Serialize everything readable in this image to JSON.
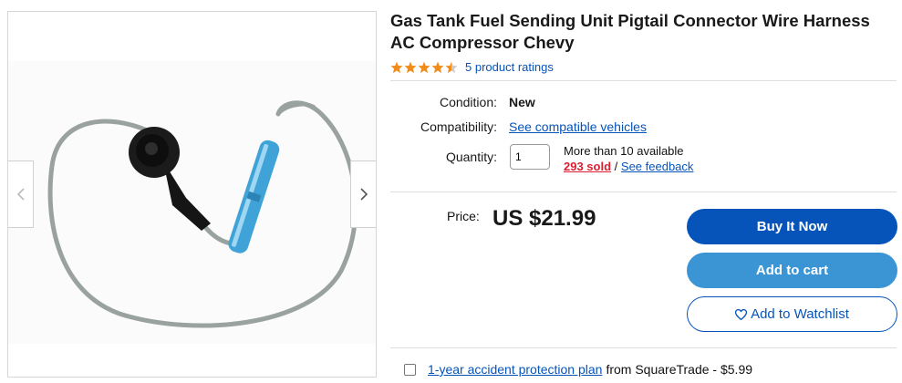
{
  "product": {
    "title": "Gas Tank Fuel Sending Unit Pigtail Connector Wire Harness AC Compressor Chevy",
    "rating_stars": 4.5,
    "ratings_link": "5 product ratings"
  },
  "details": {
    "condition_label": "Condition:",
    "condition_value": "New",
    "compat_label": "Compatibility:",
    "compat_link": "See compatible vehicles",
    "qty_label": "Quantity:",
    "qty_value": "1",
    "availability": "More than 10 available",
    "sold": "293 sold",
    "separator": "/",
    "feedback": "See feedback"
  },
  "price": {
    "label": "Price:",
    "value": "US $21.99"
  },
  "actions": {
    "buy": "Buy It Now",
    "cart": "Add to cart",
    "watch": "Add to Watchlist"
  },
  "protection": {
    "link": "1-year accident protection plan",
    "text": "from SquareTrade - $5.99"
  },
  "colors": {
    "primary_blue": "#0654ba",
    "cart_blue": "#3b95d4",
    "star_orange": "#f18c1b",
    "sold_red": "#dd1e31"
  },
  "icons": {
    "prev": "chevron-left-icon",
    "next": "chevron-right-icon",
    "watch": "heart-icon"
  }
}
